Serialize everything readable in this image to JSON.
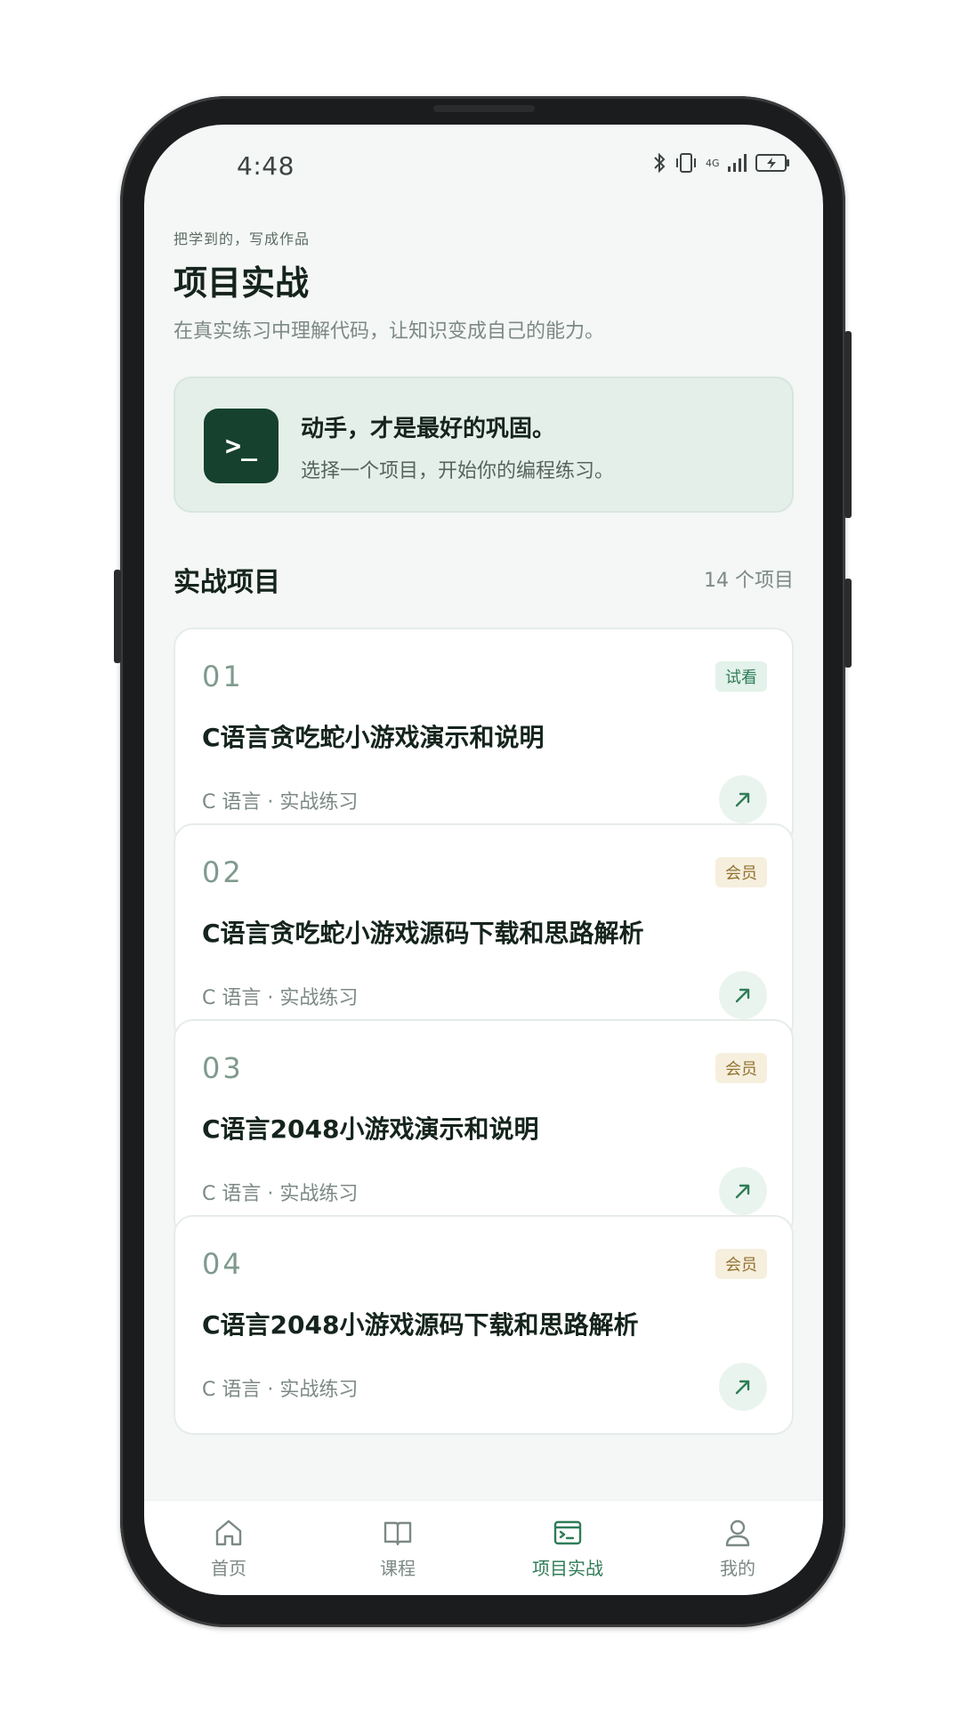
{
  "status_bar": {
    "time": "4:48",
    "network": "4G"
  },
  "header": {
    "eyebrow": "把学到的，写成作品",
    "title": "项目实战",
    "description": "在真实练习中理解代码，让知识变成自己的能力。"
  },
  "banner": {
    "icon_text": ">_",
    "title": "动手，才是最好的巩固。",
    "subtitle": "选择一个项目，开始你的编程练习。"
  },
  "section": {
    "title": "实战项目",
    "count": "14 个项目"
  },
  "projects": [
    {
      "number": "01",
      "badge": "试看",
      "badge_kind": "trial",
      "title": "C语言贪吃蛇小游戏演示和说明",
      "meta": "C 语言 · 实战练习"
    },
    {
      "number": "02",
      "badge": "会员",
      "badge_kind": "member",
      "title": "C语言贪吃蛇小游戏源码下载和思路解析",
      "meta": "C 语言 · 实战练习"
    },
    {
      "number": "03",
      "badge": "会员",
      "badge_kind": "member",
      "title": "C语言2048小游戏演示和说明",
      "meta": "C 语言 · 实战练习"
    },
    {
      "number": "04",
      "badge": "会员",
      "badge_kind": "member",
      "title": "C语言2048小游戏源码下载和思路解析",
      "meta": "C 语言 · 实战练习"
    }
  ],
  "tabs": [
    {
      "label": "首页",
      "icon": "home-icon",
      "active": false
    },
    {
      "label": "课程",
      "icon": "book-icon",
      "active": false
    },
    {
      "label": "项目实战",
      "icon": "terminal-icon",
      "active": true
    },
    {
      "label": "我的",
      "icon": "person-icon",
      "active": false
    }
  ],
  "colors": {
    "accent": "#2f7d57",
    "banner_icon_bg": "#16412f",
    "trial_badge_bg": "#e3f2ea",
    "member_badge_bg": "#f6efde"
  }
}
